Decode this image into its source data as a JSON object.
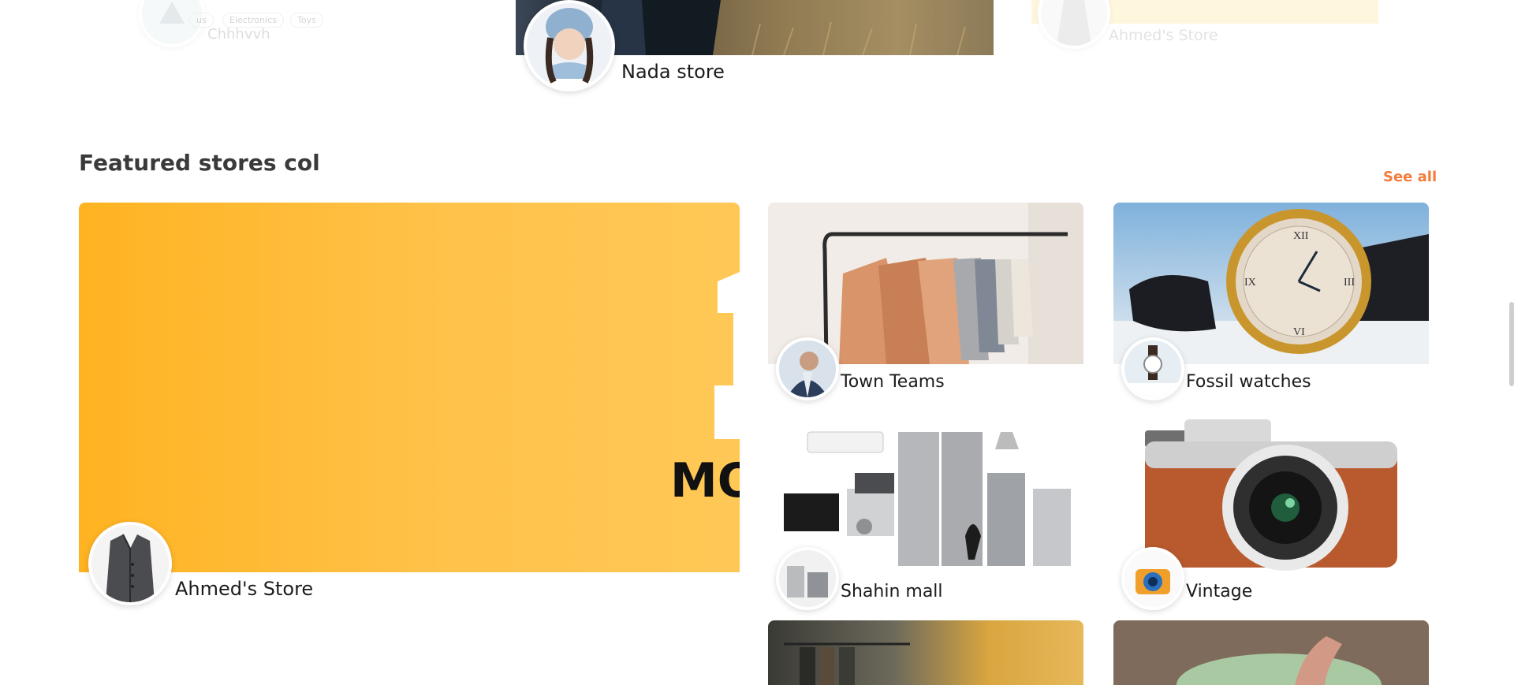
{
  "top_row": {
    "left_store": {
      "name": "Chhhvvh",
      "tags": [
        "us",
        "Electronics",
        "Toys"
      ]
    },
    "center_store": {
      "name": "Nada store"
    },
    "right_store": {
      "name": "Ahmed's Store"
    }
  },
  "section": {
    "title": "Featured stores col",
    "see_all": "See all"
  },
  "featured_large": {
    "name": "Ahmed's Store",
    "banner_text": "MO"
  },
  "stores": [
    {
      "name": "Town Teams"
    },
    {
      "name": "Fossil watches"
    },
    {
      "name": "Shahin mall"
    },
    {
      "name": "Vintage"
    }
  ],
  "colors": {
    "accent": "#f37b3b",
    "banner_start": "#ffb321",
    "banner_end": "#ffc856",
    "heading": "#3a3a3a"
  }
}
